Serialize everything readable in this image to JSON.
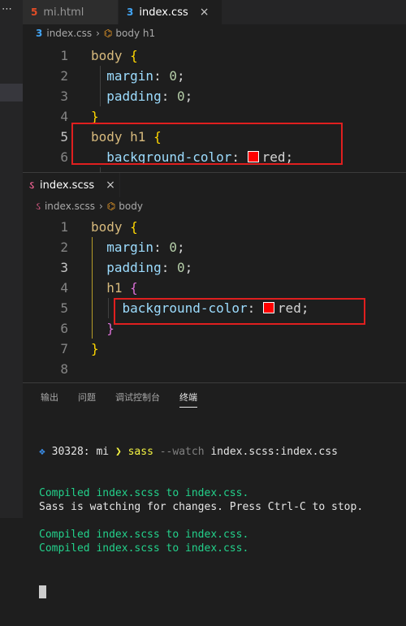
{
  "top_pane": {
    "tabs": [
      {
        "icon": "html5",
        "label": "mi.html",
        "active": false
      },
      {
        "icon": "css3",
        "label": "index.css",
        "active": true,
        "close": "×"
      }
    ],
    "breadcrumb": {
      "file": "index.css",
      "symbol": "body h1"
    },
    "lines": [
      {
        "n": "1",
        "parts": [
          [
            "sel",
            "body "
          ],
          [
            "brace",
            "{"
          ]
        ]
      },
      {
        "n": "2",
        "parts": [
          [
            "prop",
            "  margin"
          ],
          [
            "val",
            ": "
          ],
          [
            "num",
            "0"
          ],
          [
            "val",
            ";"
          ]
        ]
      },
      {
        "n": "3",
        "parts": [
          [
            "prop",
            "  padding"
          ],
          [
            "val",
            ": "
          ],
          [
            "num",
            "0"
          ],
          [
            "val",
            ";"
          ]
        ]
      },
      {
        "n": "4",
        "parts": [
          [
            "brace",
            "}"
          ]
        ]
      },
      {
        "n": "5",
        "parts": [
          [
            "sel",
            "body h1 "
          ],
          [
            "brace",
            "{"
          ]
        ]
      },
      {
        "n": "6",
        "parts": [
          [
            "prop",
            "  background-color"
          ],
          [
            "val",
            ": "
          ],
          [
            "swatch",
            ""
          ],
          [
            "val",
            "red;"
          ]
        ]
      }
    ]
  },
  "bottom_pane": {
    "tab": {
      "icon": "sass",
      "label": "index.scss",
      "close": "×"
    },
    "breadcrumb": {
      "file": "index.scss",
      "symbol": "body"
    },
    "lines": [
      {
        "n": "1",
        "parts": [
          [
            "sel",
            "body "
          ],
          [
            "brace",
            "{"
          ]
        ]
      },
      {
        "n": "2",
        "parts": [
          [
            "prop",
            "  margin"
          ],
          [
            "val",
            ": "
          ],
          [
            "num",
            "0"
          ],
          [
            "val",
            ";"
          ]
        ]
      },
      {
        "n": "3",
        "parts": [
          [
            "prop",
            "  padding"
          ],
          [
            "val",
            ": "
          ],
          [
            "num",
            "0"
          ],
          [
            "val",
            ";"
          ]
        ]
      },
      {
        "n": "4",
        "parts": [
          [
            "sel",
            "  h1 "
          ],
          [
            "brace2",
            "{"
          ]
        ]
      },
      {
        "n": "5",
        "parts": [
          [
            "prop",
            "    background-color"
          ],
          [
            "val",
            ": "
          ],
          [
            "swatch",
            ""
          ],
          [
            "val",
            "red;"
          ]
        ]
      },
      {
        "n": "6",
        "parts": [
          [
            "brace2",
            "  }"
          ]
        ]
      },
      {
        "n": "7",
        "parts": [
          [
            "brace",
            "}"
          ]
        ]
      },
      {
        "n": "8",
        "parts": []
      }
    ]
  },
  "panel": {
    "tabs": [
      "输出",
      "问题",
      "调试控制台",
      "终端"
    ],
    "active_tab": "终端",
    "terminal": {
      "prompt_pid": "30328: mi",
      "prompt_arrow": "❯",
      "command": "sass",
      "flag": "--watch",
      "args": "index.scss:index.css",
      "lines": [
        {
          "style": "green",
          "text": "Compiled index.scss to index.css."
        },
        {
          "style": "white",
          "text": "Sass is watching for changes. Press Ctrl-C to stop."
        },
        {
          "style": "white",
          "text": ""
        },
        {
          "style": "green",
          "text": "Compiled index.scss to index.css."
        },
        {
          "style": "green",
          "text": "Compiled index.scss to index.css."
        }
      ]
    }
  },
  "colors": {
    "highlight_box": "#e01f1f",
    "swatch": "#ff0000",
    "terminal_green": "#23d18b"
  }
}
